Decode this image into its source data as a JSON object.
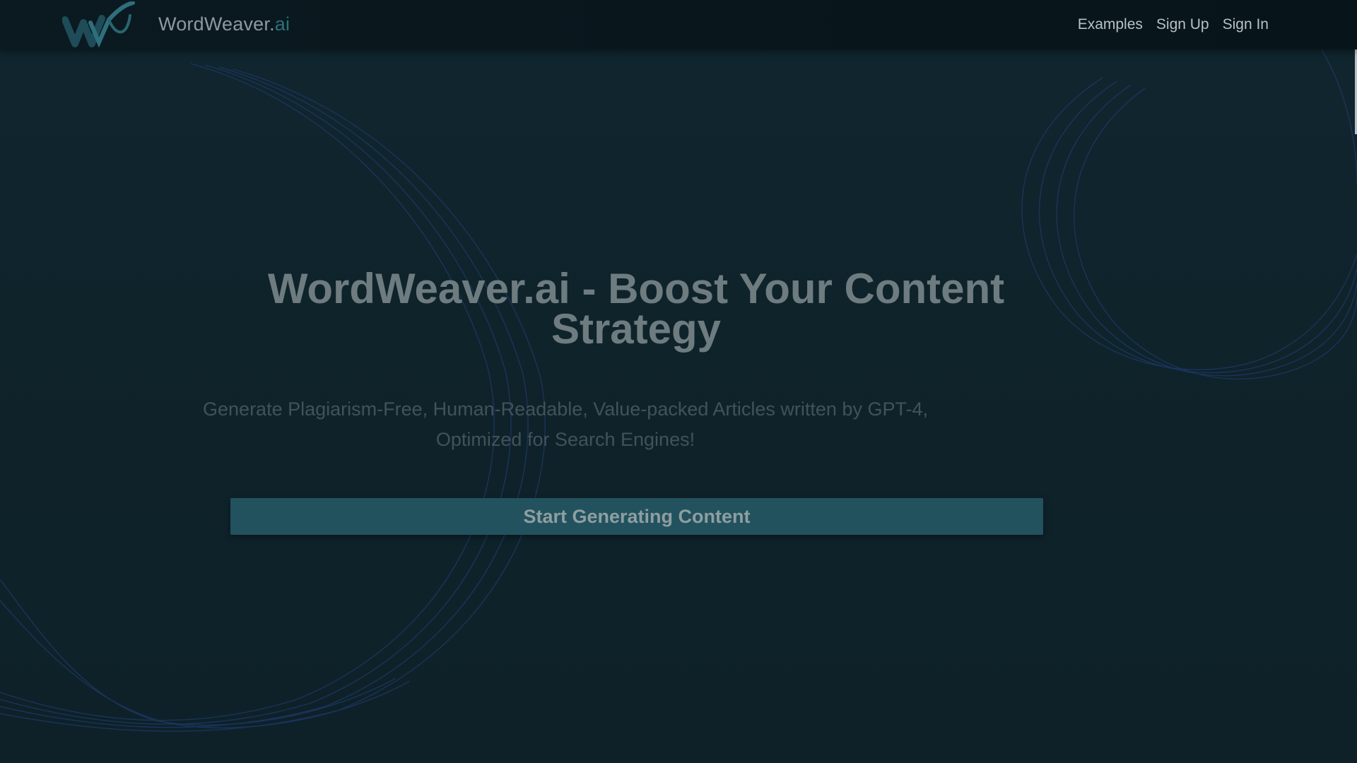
{
  "header": {
    "brand_name": "WordWeaver.",
    "brand_suffix": "ai",
    "logo_icon": "ww-logo-icon",
    "nav": [
      {
        "label": "Examples"
      },
      {
        "label": "Sign Up"
      },
      {
        "label": "Sign In"
      }
    ]
  },
  "hero": {
    "title": "WordWeaver.ai - Boost Your Content Strategy",
    "subtitle": "Generate Plagiarism-Free, Human-Readable, Value-packed Articles written by GPT-4, Optimized for Search Engines!",
    "cta_label": "Start Generating Content"
  },
  "colors": {
    "background": "#0f232b",
    "navbar": "#0b1a20",
    "accent": "#2e6f7d",
    "button": "#22525e",
    "wave_lines": "#1f3a6a"
  }
}
